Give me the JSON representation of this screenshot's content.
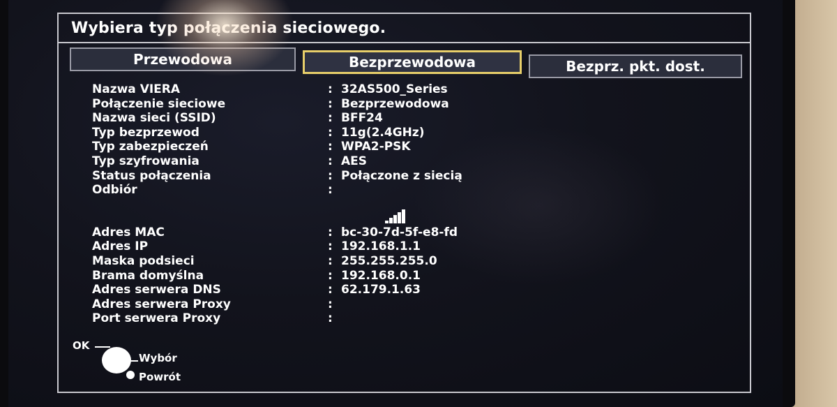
{
  "dialog": {
    "title": "Wybiera typ połączenia sieciowego."
  },
  "tabs": [
    {
      "label": "Przewodowa",
      "selected": false
    },
    {
      "label": "Bezprzewodowa",
      "selected": true
    },
    {
      "label": "Bezprz. pkt. dost.",
      "selected": false
    }
  ],
  "info_rows": [
    {
      "label": "Nazwa VIERA",
      "value": "32AS500_Series"
    },
    {
      "label": "Połączenie sieciowe",
      "value": "Bezprzewodowa"
    },
    {
      "label": "Nazwa sieci (SSID)",
      "value": "BFF24"
    },
    {
      "label": "Typ bezprzewod",
      "value": "11g(2.4GHz)"
    },
    {
      "label": "Typ zabezpieczeń",
      "value": "WPA2-PSK"
    },
    {
      "label": "Typ szyfrowania",
      "value": "AES"
    },
    {
      "label": "Status połączenia",
      "value": "Połączone z siecią"
    },
    {
      "label": "Odbiór",
      "value": ""
    }
  ],
  "signal": {
    "icon": "signal-strength-icon",
    "level": 5,
    "max": 5
  },
  "network_rows": [
    {
      "label": "Adres MAC",
      "value": "bc-30-7d-5f-e8-fd"
    },
    {
      "label": "Adres IP",
      "value": "192.168.1.1"
    },
    {
      "label": "Maska podsieci",
      "value": "255.255.255.0"
    },
    {
      "label": "Brama domyślna",
      "value": "192.168.0.1"
    },
    {
      "label": "Adres serwera DNS",
      "value": "62.179.1.63"
    },
    {
      "label": "Adres serwera Proxy",
      "value": ""
    },
    {
      "label": "Port serwera Proxy",
      "value": ""
    }
  ],
  "separator": ":",
  "footer": {
    "ok_label": "OK",
    "select_label": "Wybór",
    "return_label": "Powrót"
  },
  "colors": {
    "background": "#12131c",
    "text": "#ffffff",
    "selected_tab_border": "#e8cf6a",
    "tab_fill": "#2b2e3c"
  }
}
